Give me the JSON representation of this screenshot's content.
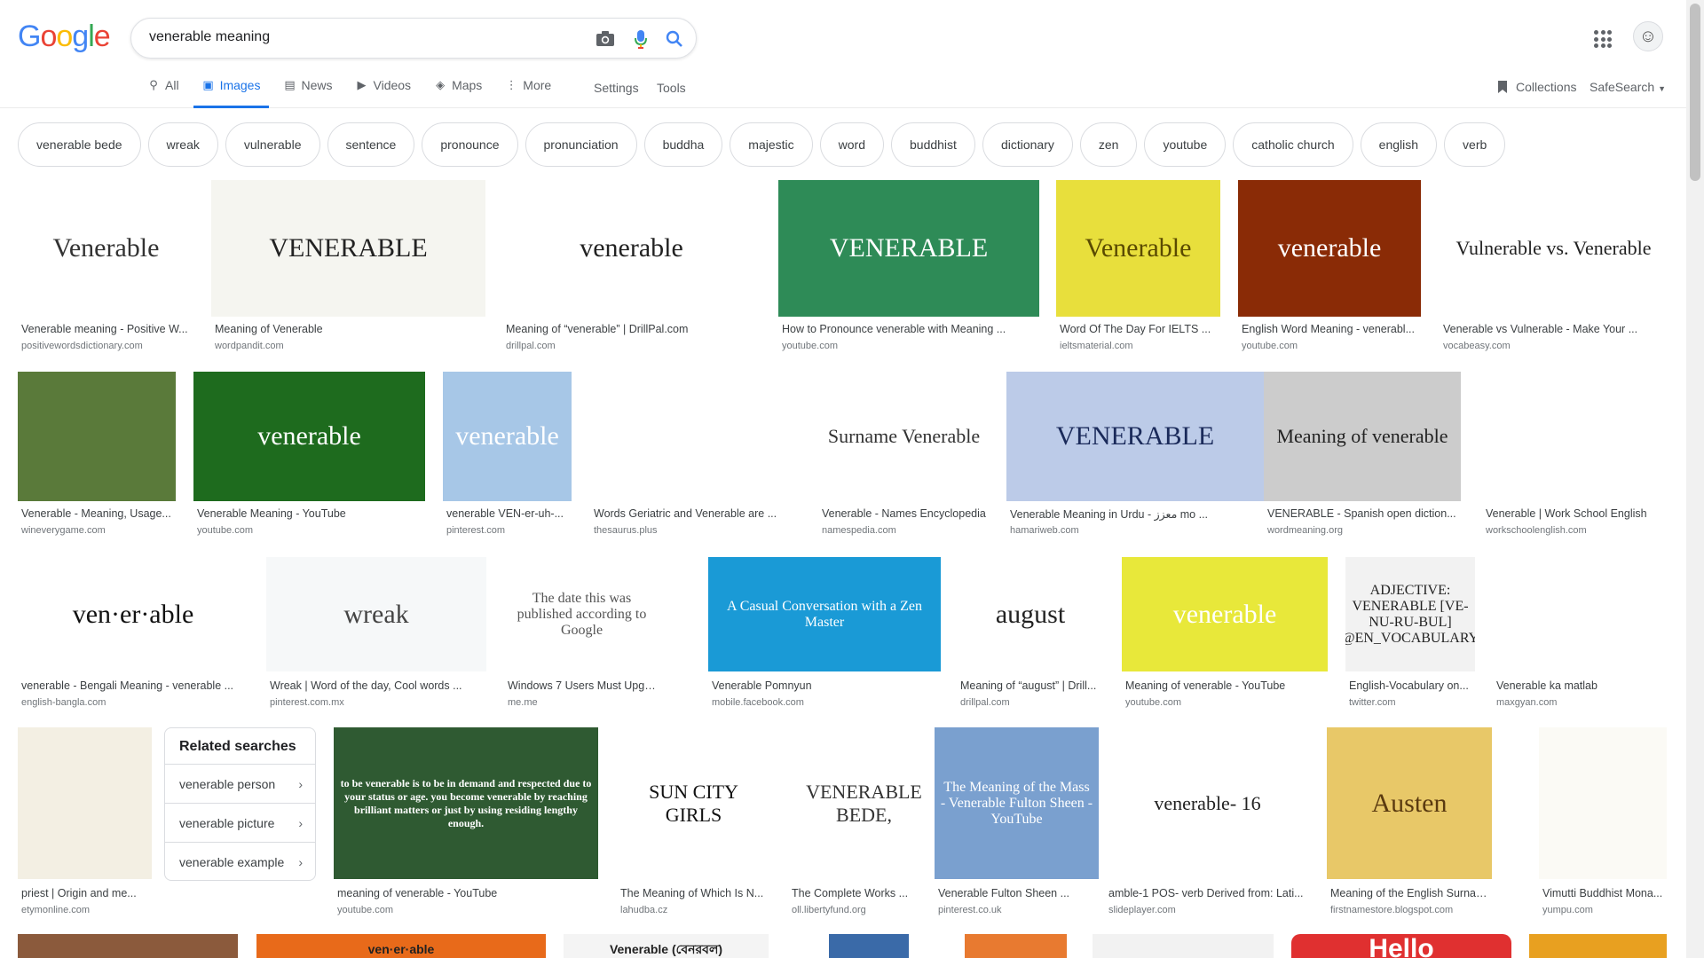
{
  "header": {
    "logo_letters": [
      "G",
      "o",
      "o",
      "g",
      "l",
      "e"
    ],
    "logo_colors": [
      "#4285f4",
      "#ea4335",
      "#fbbc05",
      "#4285f4",
      "#34a853",
      "#ea4335"
    ],
    "search_value": "venerable meaning",
    "tabs": [
      {
        "label": "All",
        "icon": "search-icon",
        "active": false
      },
      {
        "label": "Images",
        "icon": "image-icon",
        "active": true
      },
      {
        "label": "News",
        "icon": "news-icon",
        "active": false
      },
      {
        "label": "Videos",
        "icon": "play-icon",
        "active": false
      },
      {
        "label": "Maps",
        "icon": "map-icon",
        "active": false
      },
      {
        "label": "More",
        "icon": "more-vert-icon",
        "active": false
      }
    ],
    "settings_label": "Settings",
    "tools_label": "Tools",
    "collections_label": "Collections",
    "safesearch_label": "SafeSearch"
  },
  "chips": [
    "venerable bede",
    "wreak",
    "vulnerable",
    "sentence",
    "pronounce",
    "pronunciation",
    "buddha",
    "majestic",
    "word",
    "buddhist",
    "dictionary",
    "zen",
    "youtube",
    "catholic church",
    "english",
    "verb"
  ],
  "results": [
    {
      "title": "Venerable meaning - Positive W...",
      "source": "positivewordsdictionary.com",
      "thumb_text": "Venerable",
      "bg": "#ffffff",
      "fg": "#333333"
    },
    {
      "title": "Meaning of Venerable",
      "source": "wordpandit.com",
      "thumb_text": "VENERABLE",
      "bg": "#f5f5f0",
      "fg": "#222222"
    },
    {
      "title": "Meaning of “venerable” | DrillPal.com",
      "source": "drillpal.com",
      "thumb_text": "venerable",
      "bg": "#ffffff",
      "fg": "#222222"
    },
    {
      "title": "How to Pronounce venerable with Meaning ...",
      "source": "youtube.com",
      "thumb_text": "VENERABLE",
      "bg": "#2e8b57",
      "fg": "#ffffff"
    },
    {
      "title": "Word Of The Day For IELTS ...",
      "source": "ieltsmaterial.com",
      "thumb_text": "Venerable",
      "bg": "#e8df3c",
      "fg": "#5a4a00"
    },
    {
      "title": "English Word Meaning - venerabl...",
      "source": "youtube.com",
      "thumb_text": "venerable",
      "bg": "#8a2b06",
      "fg": "#ffffff"
    },
    {
      "title": "Venerable vs Vulnerable - Make Your ...",
      "source": "vocabeasy.com",
      "thumb_text": "Vulnerable vs. Venerable",
      "bg": "#ffffff",
      "fg": "#222222"
    },
    {
      "title": "Venerable - Meaning, Usage...",
      "source": "wineverygame.com",
      "thumb_text": "",
      "bg": "#5a7a3a",
      "fg": "#ffffff"
    },
    {
      "title": "Venerable Meaning - YouTube",
      "source": "youtube.com",
      "thumb_text": "venerable",
      "bg": "#1e6b1e",
      "fg": "#ffffff"
    },
    {
      "title": "venerable VEN-er-uh-...",
      "source": "pinterest.com",
      "thumb_text": "venerable",
      "bg": "#a7c7e7",
      "fg": "#ffffff"
    },
    {
      "title": "Words Geriatric and Venerable are ...",
      "source": "thesaurus.plus",
      "thumb_text": "",
      "bg": "#ffffff",
      "fg": "#444444"
    },
    {
      "title": "Venerable - Names Encyclopedia",
      "source": "namespedia.com",
      "thumb_text": "Surname Venerable",
      "bg": "#ffffff",
      "fg": "#333333"
    },
    {
      "title": "Venerable Meaning in Urdu - معزز mo ...",
      "source": "hamariweb.com",
      "thumb_text": "VENERABLE",
      "bg": "#bccbe8",
      "fg": "#1a2a5a"
    },
    {
      "title": "VENERABLE - Spanish open diction...",
      "source": "wordmeaning.org",
      "thumb_text": "Meaning of venerable",
      "bg": "#cccccc",
      "fg": "#222222"
    },
    {
      "title": "Venerable | Work School English",
      "source": "workschoolenglish.com",
      "thumb_text": "",
      "bg": "#ffffff",
      "fg": "#222222"
    },
    {
      "title": "venerable - Bengali Meaning - venerable ...",
      "source": "english-bangla.com",
      "thumb_text": "ven·er·able",
      "bg": "#ffffff",
      "fg": "#111111"
    },
    {
      "title": "Wreak | Word of the day, Cool words ...",
      "source": "pinterest.com.mx",
      "thumb_text": "wreak",
      "bg": "#f6f8f9",
      "fg": "#444444"
    },
    {
      "title": "Windows 7 Users Must Upgrade t...",
      "source": "me.me",
      "thumb_text": "The date this was published according to Google",
      "bg": "#ffffff",
      "fg": "#555555"
    },
    {
      "title": "Venerable Pomnyun",
      "source": "mobile.facebook.com",
      "thumb_text": "A Casual Conversation with a Zen Master",
      "bg": "#1a9ad6",
      "fg": "#ffffff"
    },
    {
      "title": "Meaning of “august” | Drill...",
      "source": "drillpal.com",
      "thumb_text": "august",
      "bg": "#ffffff",
      "fg": "#222222"
    },
    {
      "title": "Meaning of venerable - YouTube",
      "source": "youtube.com",
      "thumb_text": "venerable",
      "bg": "#e8e83a",
      "fg": "#ffffff"
    },
    {
      "title": "English-Vocabulary on...",
      "source": "twitter.com",
      "thumb_text": "ADJECTIVE: VENERABLE [VE-NU-RU-BUL] @EN_VOCABULARY",
      "bg": "#f2f2f2",
      "fg": "#222222"
    },
    {
      "title": "Venerable ka matlab",
      "source": "maxgyan.com",
      "thumb_text": "",
      "bg": "#ffffff",
      "fg": "#4a7ac8"
    },
    {
      "title": "priest | Origin and me...",
      "source": "etymonline.com",
      "thumb_text": "",
      "bg": "#f3efe3",
      "fg": "#666666"
    },
    {
      "title": "meaning of venerable - YouTube",
      "source": "youtube.com",
      "thumb_text": "to be venerable is to be in demand and respected due to your status or age. you become venerable by reaching brilliant matters or just by using residing lengthy enough.",
      "bg": "#2f5a32",
      "fg": "#ffffff"
    },
    {
      "title": "The Meaning of Which Is N...",
      "source": "lahudba.cz",
      "thumb_text": "SUN CITY GIRLS",
      "bg": "#ffffff",
      "fg": "#111111"
    },
    {
      "title": "The Complete Works ...",
      "source": "oll.libertyfund.org",
      "thumb_text": "VENERABLE BEDE,",
      "bg": "#ffffff",
      "fg": "#333333"
    },
    {
      "title": "Venerable Fulton Sheen ...",
      "source": "pinterest.co.uk",
      "thumb_text": "The Meaning of the Mass - Venerable Fulton Sheen - YouTube",
      "bg": "#7aa0cf",
      "fg": "#ffffff"
    },
    {
      "title": "amble-1 POS- verb Derived from: Lati...",
      "source": "slideplayer.com",
      "thumb_text": "venerable- 16",
      "bg": "#ffffff",
      "fg": "#222222"
    },
    {
      "title": "Meaning of the English Surname Au...",
      "source": "firstnamestore.blogspot.com",
      "thumb_text": "Austen",
      "bg": "#e8c868",
      "fg": "#5a3a10"
    },
    {
      "title": "Vimutti Buddhist Mona...",
      "source": "yumpu.com",
      "thumb_text": "",
      "bg": "#fbfaf5",
      "fg": "#555555"
    }
  ],
  "related": {
    "title": "Related searches",
    "items": [
      "venerable person",
      "venerable picture",
      "venerable example"
    ]
  },
  "bottom_thumbs": [
    {
      "bg": "#8b5a3c",
      "text": ""
    },
    {
      "bg": "#e86a1a",
      "text": "ven·er·able"
    },
    {
      "bg": "#f4f4f4",
      "text": "Venerable (বেনরবল)"
    },
    {
      "bg": "#3a6aa8",
      "text": ""
    },
    {
      "bg": "#e87a30",
      "text": ""
    },
    {
      "bg": "#f2f2f2",
      "text": ""
    },
    {
      "bg": "#e03030",
      "text": "Hello"
    },
    {
      "bg": "#e8a020",
      "text": ""
    }
  ]
}
